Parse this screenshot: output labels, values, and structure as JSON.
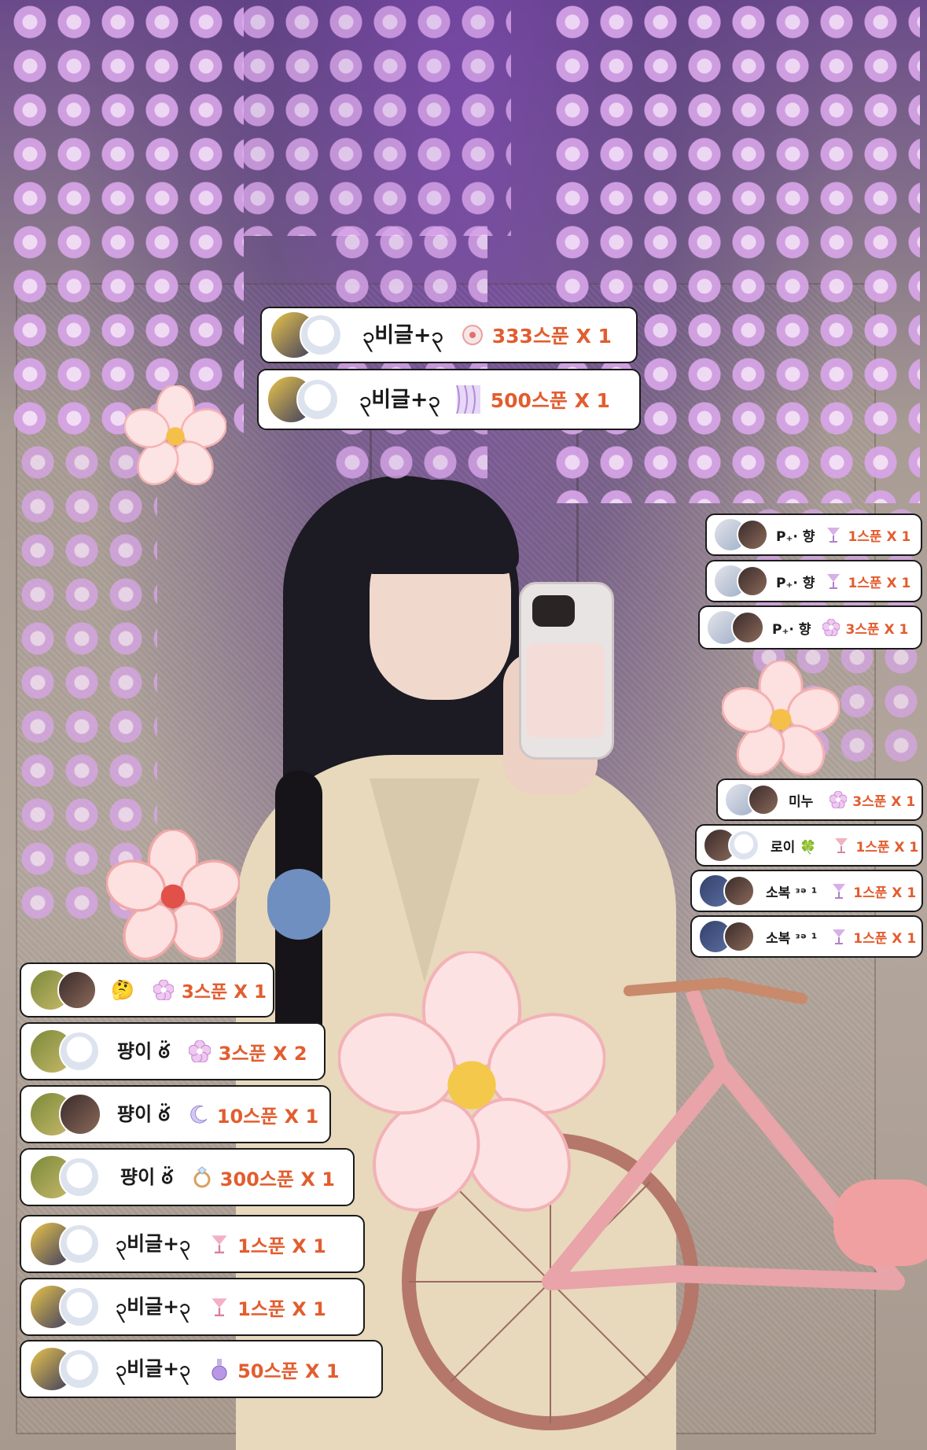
{
  "gifts_top": [
    {
      "name": "၃비글+၃",
      "amount": "333스푼 X 1",
      "gift_icon": "sparkle-gift-icon"
    },
    {
      "name": "၃비글+၃",
      "amount": "500스푼 X 1",
      "gift_icon": "curtain-gift-icon"
    }
  ],
  "gifts_right": [
    {
      "name": "P₊· 향",
      "amount": "1스푼 X 1",
      "gift_icon": "cocktail-gift-icon"
    },
    {
      "name": "P₊· 향",
      "amount": "1스푼 X 1",
      "gift_icon": "cocktail-gift-icon"
    },
    {
      "name": "P₊· 향",
      "amount": "3스푼 X 1",
      "gift_icon": "flower-gift-icon"
    },
    {
      "name": "미누",
      "amount": "3스푼 X 1",
      "gift_icon": "flower-gift-icon"
    },
    {
      "name": "로이 🍀",
      "amount": "1스푼 X 1",
      "gift_icon": "cocktail-gift-icon"
    },
    {
      "name": "소복 ᵌᵊ ¹",
      "amount": "1스푼 X 1",
      "gift_icon": "cocktail-gift-icon"
    },
    {
      "name": "소복 ᵌᵊ ¹",
      "amount": "1스푼 X 1",
      "gift_icon": "cocktail-gift-icon"
    }
  ],
  "gifts_left": [
    {
      "name": "🤔",
      "amount": "3스푼 X 1",
      "gift_icon": "flower-gift-icon"
    },
    {
      "name": "퍙이 ఠ̈",
      "amount": "3스푼 X 2",
      "gift_icon": "flower-gift-icon"
    },
    {
      "name": "퍙이 ఠ̈",
      "amount": "10스푼 X 1",
      "gift_icon": "moon-gift-icon"
    },
    {
      "name": "퍙이 ఠ̈",
      "amount": "300스푼 X 1",
      "gift_icon": "ring-gift-icon"
    },
    {
      "name": "၃비글+၃",
      "amount": "1스푼 X 1",
      "gift_icon": "cocktail-gift-icon"
    },
    {
      "name": "၃비글+၃",
      "amount": "1스푼 X 1",
      "gift_icon": "cocktail-gift-icon"
    },
    {
      "name": "၃비글+၃",
      "amount": "50스푼 X 1",
      "gift_icon": "potion-gift-icon"
    }
  ],
  "colors": {
    "amount": "#e25d2f",
    "badge_bg": "#ffffff",
    "badge_border": "#1a1a1a"
  }
}
